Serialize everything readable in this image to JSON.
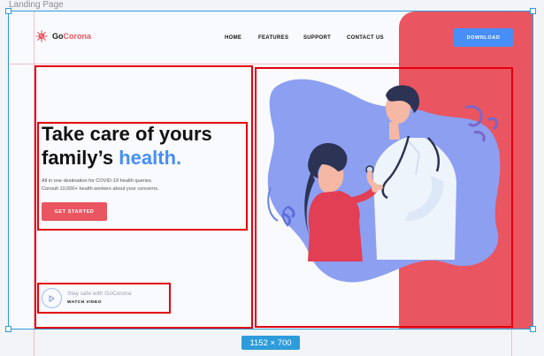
{
  "canvas": {
    "frame_label": "Landing Page",
    "dimensions_badge": "1152 × 700"
  },
  "header": {
    "brand_prefix": "Go",
    "brand_suffix": "Corona",
    "nav": [
      {
        "label": "HOME"
      },
      {
        "label": "FEATURES"
      },
      {
        "label": "SUPPORT"
      },
      {
        "label": "CONTACT US"
      }
    ],
    "download_label": "DOWNLOAD"
  },
  "hero": {
    "title_line1": "Take care of yours",
    "title_line2_prefix": "family’s ",
    "title_line2_accent": "health.",
    "subtitle_line1": "All in one destination for COVID-19 health queries.",
    "subtitle_line2": "Consult 10,000+ health workers about your concerns.",
    "cta_label": "GET STARTED"
  },
  "video": {
    "tagline": "Stay safe with GoCorona",
    "link_label": "WATCH VIDEO"
  },
  "colors": {
    "accent_red": "#e95561",
    "accent_blue": "#478ef6",
    "selection_blue": "#2d9cdb",
    "annotation_red": "#e3000b"
  },
  "icons": {
    "logo": "virus-icon",
    "play": "play-icon"
  }
}
